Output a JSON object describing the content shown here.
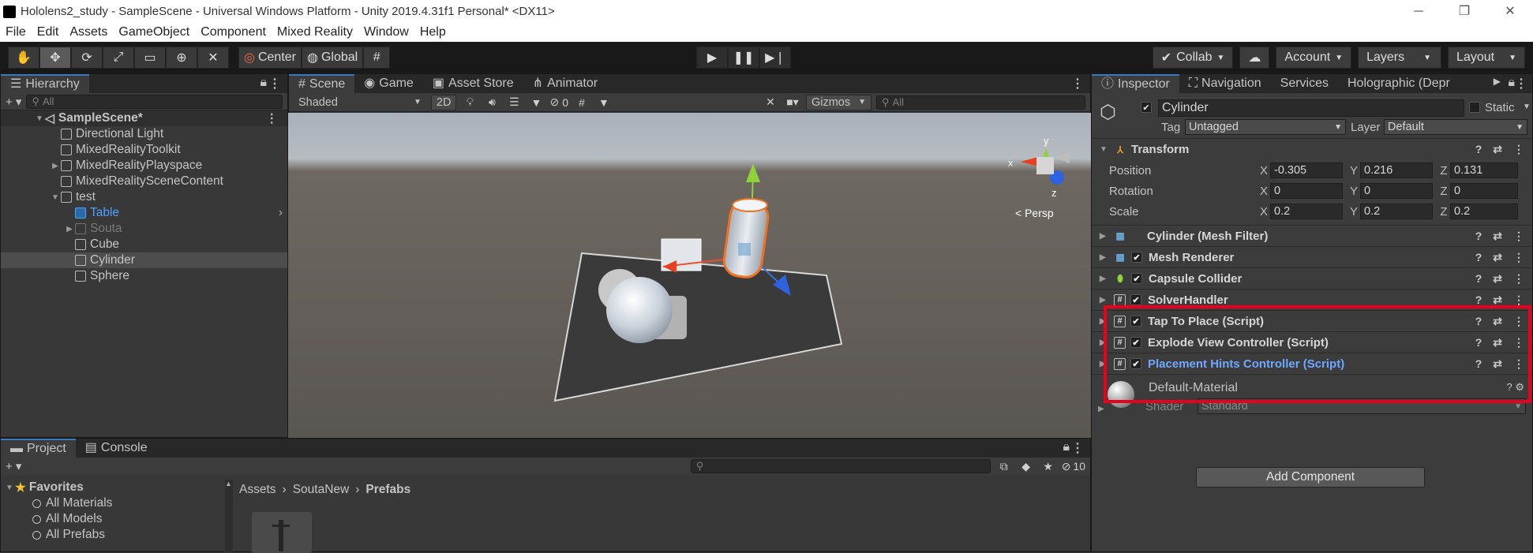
{
  "window": {
    "title": "Hololens2_study - SampleScene - Universal Windows Platform - Unity 2019.4.31f1 Personal* <DX11>",
    "minimize": "─",
    "restore": "❐",
    "close": "✕"
  },
  "menu": [
    "File",
    "Edit",
    "Assets",
    "GameObject",
    "Component",
    "Mixed Reality",
    "Window",
    "Help"
  ],
  "toolbar": {
    "tools": [
      "hand-tool-icon",
      "move-tool-icon",
      "rotate-tool-icon",
      "scale-tool-icon",
      "rect-tool-icon",
      "transform-tool-icon",
      "custom-tool-icon"
    ],
    "pivot_label": "Center",
    "space_label": "Global",
    "collab_label": "Collab",
    "account_label": "Account",
    "layers_label": "Layers",
    "layout_label": "Layout"
  },
  "hierarchy": {
    "tab": "Hierarchy",
    "search_placeholder": "All",
    "scene": "SampleScene*",
    "items": [
      {
        "label": "Directional Light"
      },
      {
        "label": "MixedRealityToolkit"
      },
      {
        "label": "MixedRealityPlayspace"
      },
      {
        "label": "MixedRealitySceneContent"
      },
      {
        "label": "test"
      },
      {
        "label": "Table"
      },
      {
        "label": "Souta"
      },
      {
        "label": "Cube"
      },
      {
        "label": "Cylinder"
      },
      {
        "label": "Sphere"
      }
    ]
  },
  "scene": {
    "tabs": [
      "Scene",
      "Game",
      "Asset Store",
      "Animator"
    ],
    "shading": "Shaded",
    "mode_2d": "2D",
    "hidden_count": "0",
    "gizmos": "Gizmos",
    "search_placeholder": "All",
    "persp": "Persp",
    "axis_x": "x",
    "axis_y": "y",
    "axis_z": "z"
  },
  "inspector": {
    "tabs": [
      "Inspector",
      "Navigation",
      "Services",
      "Holographic (Depr"
    ],
    "object_name": "Cylinder",
    "static_label": "Static",
    "tag_label": "Tag",
    "tag_value": "Untagged",
    "layer_label": "Layer",
    "layer_value": "Default",
    "transform": {
      "title": "Transform",
      "position_label": "Position",
      "rotation_label": "Rotation",
      "scale_label": "Scale",
      "position": [
        "-0.305",
        "0.216",
        "0.131"
      ],
      "rotation": [
        "0",
        "0",
        "0"
      ],
      "scale": [
        "0.2",
        "0.2",
        "0.2"
      ],
      "x": "X",
      "y": "Y",
      "z": "Z"
    },
    "components": [
      "Cylinder (Mesh Filter)",
      "Mesh Renderer",
      "Capsule Collider",
      "SolverHandler",
      "Tap To Place (Script)",
      "Explode View Controller (Script)",
      "Placement Hints Controller (Script)"
    ],
    "material_name": "Default-Material",
    "shader_label": "Shader",
    "shader_value": "Standard",
    "add_component": "Add Component",
    "highlight_color": "#e8001c"
  },
  "project": {
    "tabs": [
      "Project",
      "Console"
    ],
    "favorites_label": "Favorites",
    "favorites": [
      "All Materials",
      "All Models",
      "All Prefabs"
    ],
    "breadcrumb": [
      "Assets",
      "SoutaNew",
      "Prefabs"
    ],
    "hidden_count": "10"
  }
}
